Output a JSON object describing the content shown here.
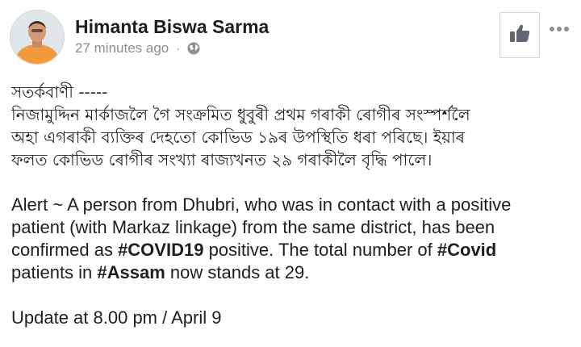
{
  "post": {
    "author": "Himanta Biswa Sarma",
    "timestamp": "27 minutes ago",
    "separator": "·",
    "privacy_icon": "globe-icon",
    "like_icon": "thumbs-up-icon",
    "more_icon": "more-dots-icon"
  },
  "content": {
    "assamese_heading": "সতৰ্কবাণী  -----",
    "assamese_line1": "নিজামুদ্দিন মাৰ্কাজলৈ গৈ  সংক্ৰমিত ধুবুৰী প্ৰথম গৰাকী ৰোগীৰ সংস্পৰ্শলৈ",
    "assamese_line2": "অহা এগৰাকী ব্যক্তিৰ দেহতো কোভিড ১৯ৰ উপস্থিতি ধৰা পৰিছে।  ইয়াৰ",
    "assamese_line3": "ফলত কোভিড ৰোগীৰ সংখ্যা ৰাজ্যখনত ২৯ গৰাকীলৈ বৃদ্ধি পালে।",
    "english_line1": "Alert ~ A person from Dhubri, who was in contact with a positive",
    "english_line2": "patient (with Markaz linkage) from the same district, has been",
    "english_line3_pre": "confirmed as ",
    "english_line3_tag": "#COVID19",
    "english_line3_post": " positive. The total number of ",
    "english_line3_tag2": "#Covid",
    "english_line4_pre": "patients in ",
    "english_line4_tag": "#Assam",
    "english_line4_post": " now stands at 29.",
    "update_line": "Update at 8.00 pm / April 9"
  },
  "colors": {
    "text": "#1c1e21",
    "meta": "#8a8d91",
    "avatar_bg": "#f29a3a"
  }
}
